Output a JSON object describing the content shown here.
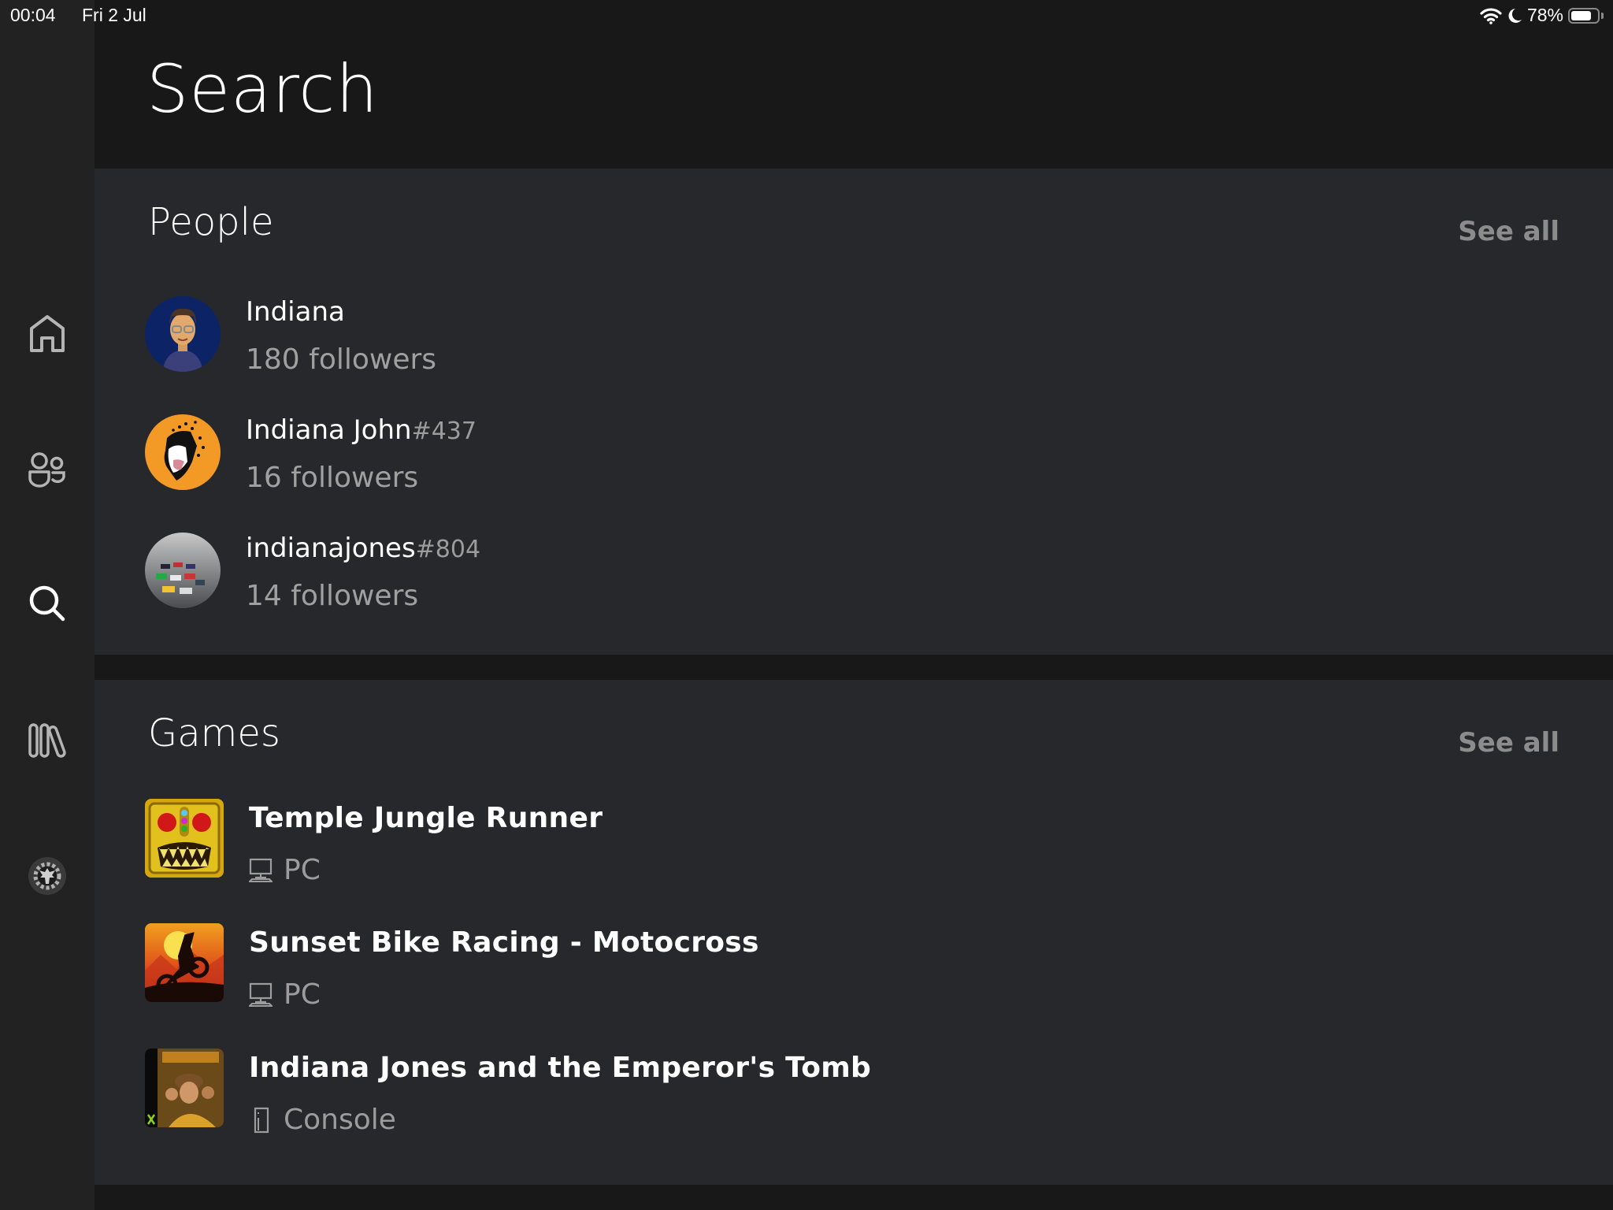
{
  "status_bar": {
    "time": "00:04",
    "date": "Fri 2 Jul",
    "battery_percent_label": "78%",
    "battery_level": 0.78,
    "icons": [
      "wifi-icon",
      "do-not-disturb-moon-icon",
      "battery-icon"
    ]
  },
  "sidebar": {
    "items": [
      {
        "name": "home",
        "icon": "home-icon",
        "active": false
      },
      {
        "name": "social",
        "icon": "people-icon",
        "active": false
      },
      {
        "name": "search",
        "icon": "search-icon",
        "active": true
      },
      {
        "name": "library",
        "icon": "library-icon",
        "active": false
      },
      {
        "name": "profile",
        "icon": "profile-avatar-icon",
        "active": false
      }
    ]
  },
  "header": {
    "title": "Search"
  },
  "people": {
    "title": "People",
    "see_all": "See all",
    "items": [
      {
        "name": "Indiana",
        "tag": "",
        "followers": "180 followers",
        "avatar": "avatar-cartoon-man"
      },
      {
        "name": "Indiana John",
        "tag": "#437",
        "followers": "16 followers",
        "avatar": "avatar-cheetah"
      },
      {
        "name": "indianajones",
        "tag": "#804",
        "followers": "14 followers",
        "avatar": "avatar-racing-cars"
      }
    ]
  },
  "games": {
    "title": "Games",
    "see_all": "See all",
    "items": [
      {
        "title": "Temple Jungle Runner",
        "platform": "PC",
        "platform_icon": "pc-monitor-icon"
      },
      {
        "title": "Sunset Bike Racing - Motocross",
        "platform": "PC",
        "platform_icon": "pc-monitor-icon"
      },
      {
        "title": "Indiana Jones and the Emperor's Tomb",
        "platform": "Console",
        "platform_icon": "console-icon"
      }
    ]
  },
  "colors": {
    "background": "#181818",
    "sidebar": "#222222",
    "section": "#27282c",
    "secondary_text": "#a0a0a0",
    "see_all": "#8c8c8c"
  }
}
